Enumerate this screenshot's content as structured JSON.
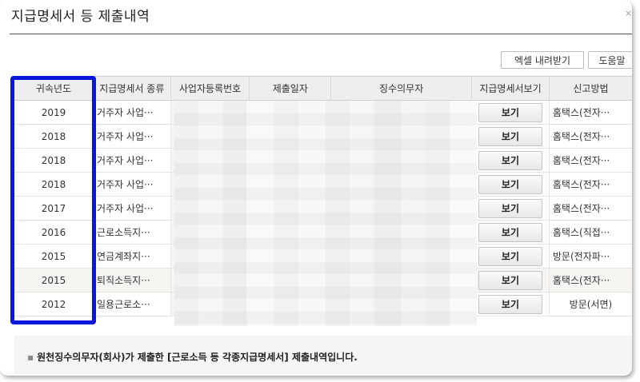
{
  "dialog": {
    "title": "지급명세서 등 제출내역",
    "close_glyph": "×"
  },
  "toolbar": {
    "excel_label": "엑셀 내려받기",
    "help_label": "도움말"
  },
  "table": {
    "headers": [
      "귀속년도",
      "지급명세서 종류",
      "사업자등록번호",
      "제출일자",
      "징수의무자",
      "지급명세서보기",
      "신고방법"
    ],
    "view_label": "보기",
    "rows": [
      {
        "year": "2019",
        "type": "거주자 사업···",
        "method": "홈택스(전자···"
      },
      {
        "year": "2018",
        "type": "거주자 사업···",
        "method": "홈택스(전자···"
      },
      {
        "year": "2018",
        "type": "거주자 사업···",
        "method": "홈택스(전자···"
      },
      {
        "year": "2018",
        "type": "거주자 사업···",
        "method": "홈택스(전자···"
      },
      {
        "year": "2017",
        "type": "거주자 사업···",
        "method": "홈택스(전자···"
      },
      {
        "year": "2016",
        "type": "근로소득지···",
        "method": "홈택스(직접···"
      },
      {
        "year": "2015",
        "type": "연금계좌지···",
        "method": "방문(전자파···"
      },
      {
        "year": "2015",
        "type": "퇴직소득지···",
        "method": "홈택스(전자···"
      },
      {
        "year": "2012",
        "type": "일용근로소···",
        "method": "방문(서면)"
      }
    ]
  },
  "footer": {
    "bullet": "▪",
    "note": "원천징수의무자(회사)가 제출한 [근로소득 등 각종지급명세서] 제출내역입니다."
  },
  "colors": {
    "highlight": "#0a16d8",
    "header_bg": "#eeeeee"
  }
}
